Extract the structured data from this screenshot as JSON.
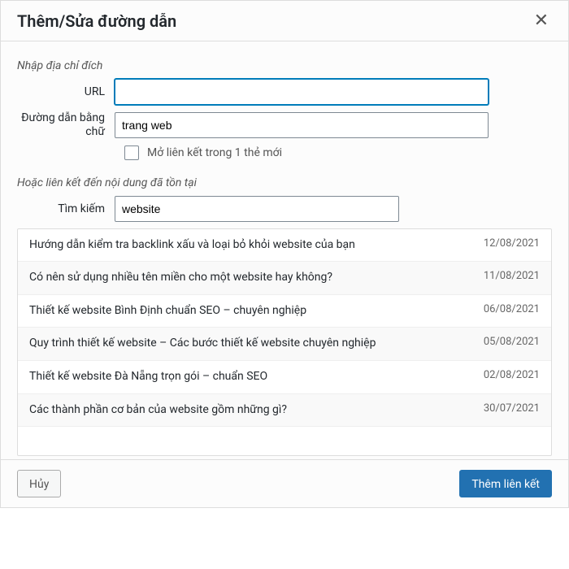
{
  "dialog": {
    "title": "Thêm/Sửa đường dẫn"
  },
  "labels": {
    "enter_destination": "Nhập địa chỉ đích",
    "url": "URL",
    "link_text": "Đường dẫn bằng chữ",
    "open_new_tab": "Mở liên kết trong 1 thẻ mới",
    "or_link_existing": "Hoặc liên kết đến nội dung đã tồn tại",
    "search": "Tìm kiếm"
  },
  "inputs": {
    "url_value": "",
    "link_text_value": "trang web",
    "search_value": "website"
  },
  "results": [
    {
      "title": "Hướng dẫn kiểm tra backlink xấu và loại bỏ khỏi website của bạn",
      "date": "12/08/2021"
    },
    {
      "title": "Có nên sử dụng nhiều tên miền cho một website hay không?",
      "date": "11/08/2021"
    },
    {
      "title": "Thiết kế website Bình Định chuẩn SEO – chuyên nghiệp",
      "date": "06/08/2021"
    },
    {
      "title": "Quy trình thiết kế website – Các bước thiết kế website chuyên nghiệp",
      "date": "05/08/2021"
    },
    {
      "title": "Thiết kế website Đà Nẵng trọn gói – chuẩn SEO",
      "date": "02/08/2021"
    },
    {
      "title": "Các thành phần cơ bản của website gồm những gì?",
      "date": "30/07/2021"
    }
  ],
  "buttons": {
    "cancel": "Hủy",
    "add_link": "Thêm liên kết"
  }
}
